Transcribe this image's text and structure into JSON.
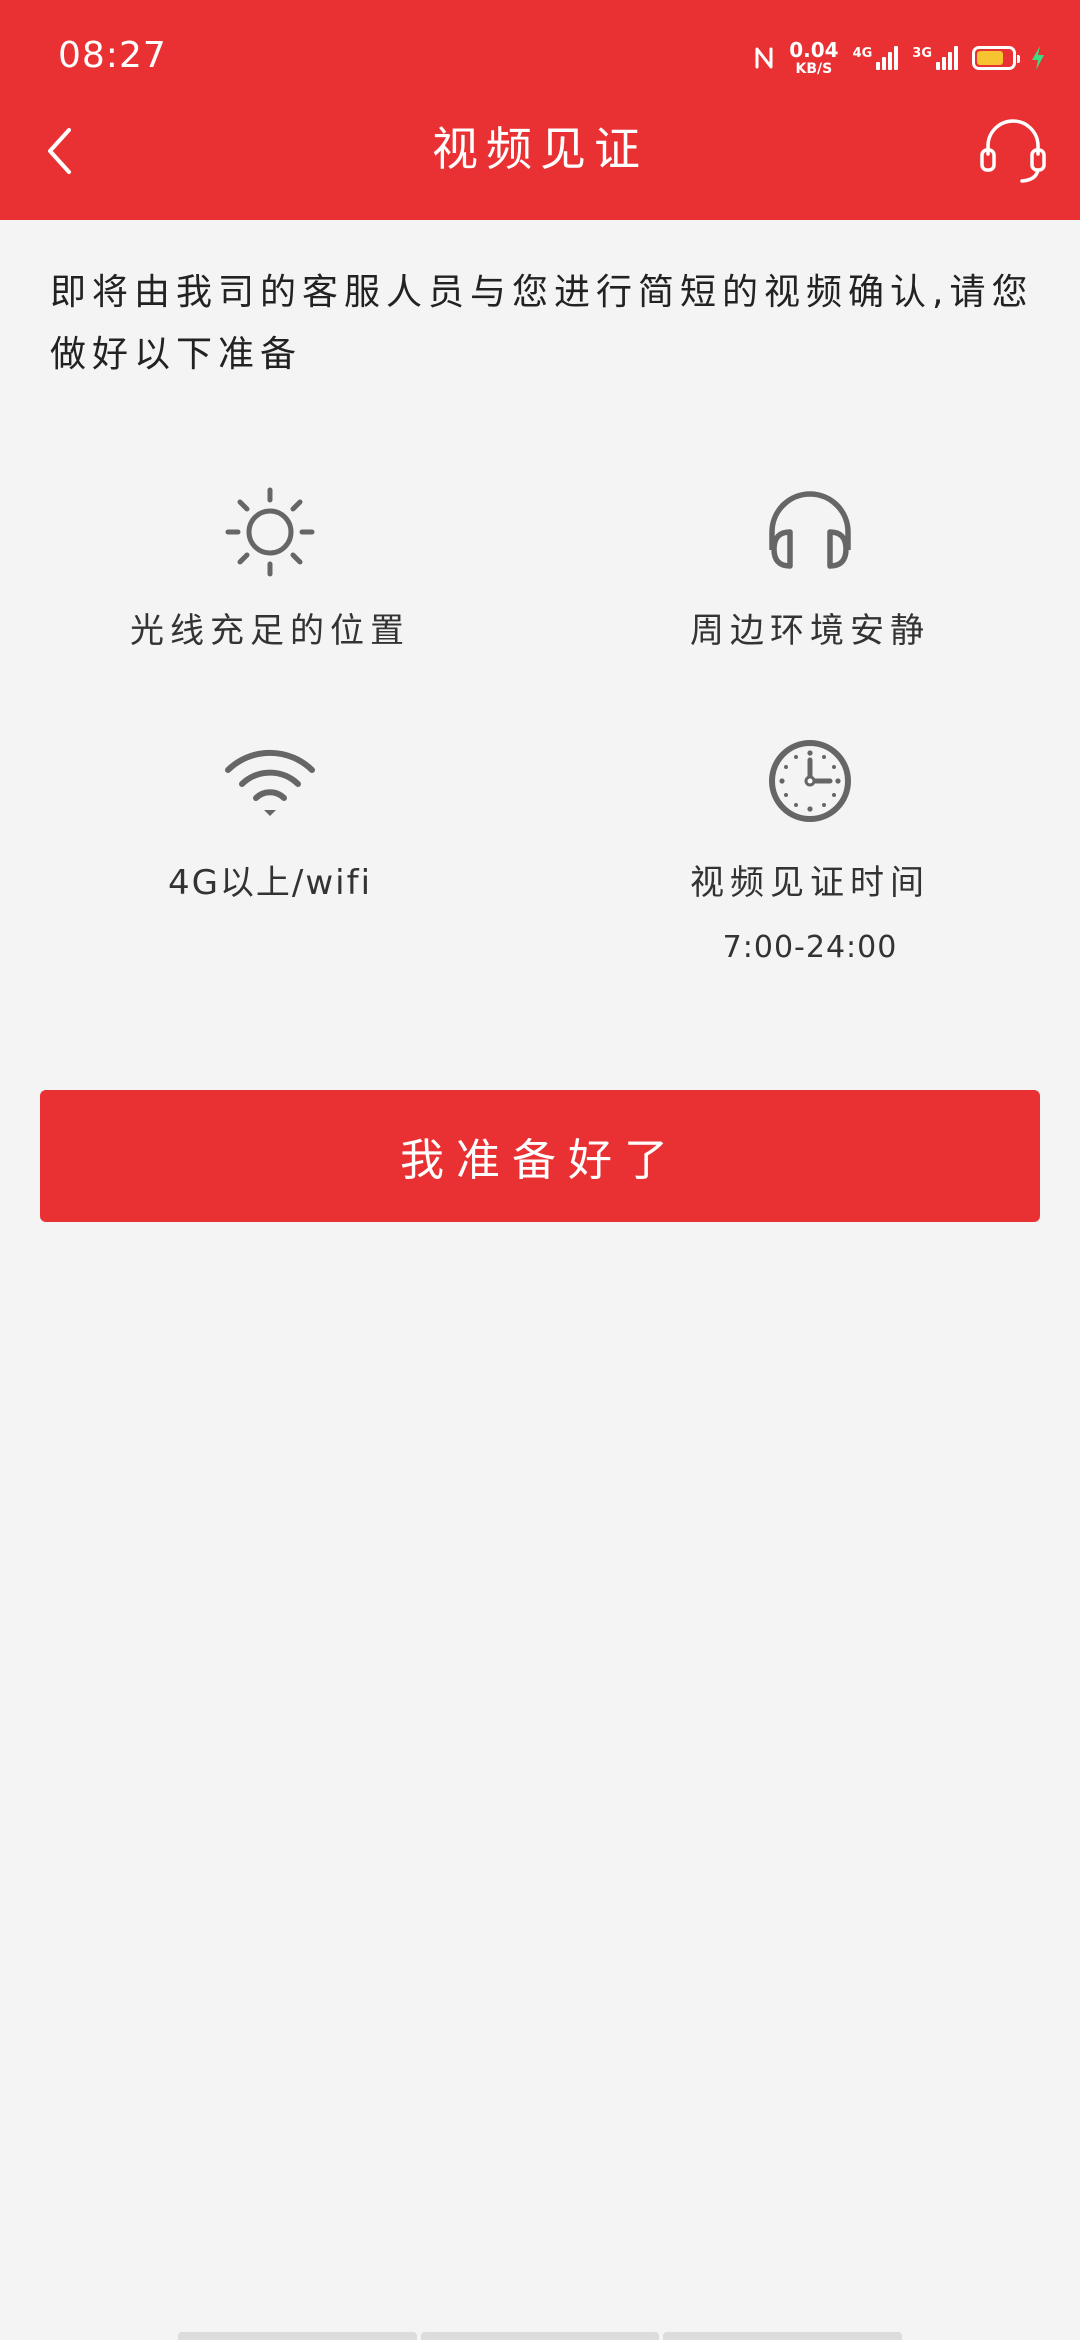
{
  "status_bar": {
    "time": "08:27",
    "net_speed_value": "0.04",
    "net_speed_unit": "KB/S",
    "sim1_label": "4G",
    "sim2_label": "3G",
    "battery_level": 0.75,
    "battery_color": "#f6c331",
    "charging_color": "#3ddc84"
  },
  "header": {
    "title": "视频见证",
    "background": "#e93133",
    "back_icon": "chevron-left-icon",
    "support_icon": "headset-icon"
  },
  "intro": {
    "text": "即将由我司的客服人员与您进行简短的视频确认,请您做好以下准备"
  },
  "tips": [
    {
      "icon": "sun-icon",
      "label": "光线充足的位置"
    },
    {
      "icon": "headphones-icon",
      "label": "周边环境安静"
    },
    {
      "icon": "wifi-icon",
      "label": "4G以上/wifi"
    },
    {
      "icon": "clock-icon",
      "label": "视频见证时间",
      "sub": "7:00-24:00"
    }
  ],
  "ready_button": {
    "label": "我准备好了",
    "color": "#e93133"
  }
}
